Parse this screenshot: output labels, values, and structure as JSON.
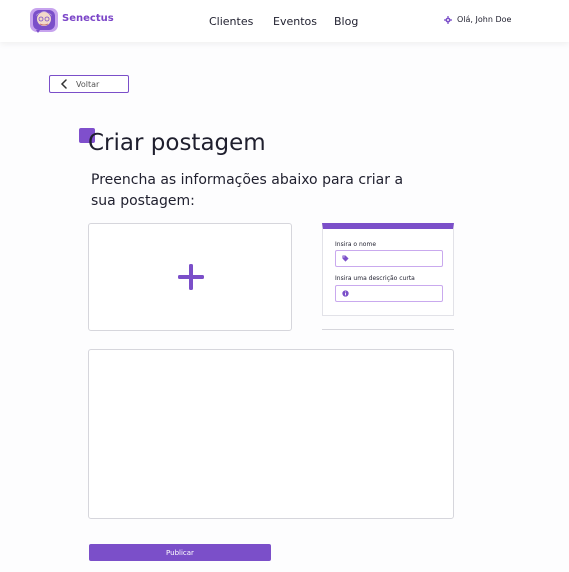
{
  "header": {
    "brand": "Senectus",
    "nav": [
      "Clientes",
      "Eventos",
      "Blog"
    ],
    "user_greeting": "Olá, John Doe"
  },
  "back_label": "Voltar",
  "page": {
    "title": "Criar postagem",
    "subtitle": "Preencha as informações abaixo para criar a sua postagem:"
  },
  "form": {
    "name_label": "Insira o nome",
    "name_value": "",
    "description_label": "Insira uma descrição curta",
    "description_value": ""
  },
  "content_value": "",
  "publish_label": "Publicar",
  "icons": {
    "logo": "grandma-avatar-icon",
    "user": "settings-icon",
    "back": "chevron-left-icon",
    "upload": "plus-icon",
    "name": "tag-icon",
    "description": "info-icon"
  },
  "colors": {
    "accent": "#7b4fc9",
    "field_border": "#c9a9ee"
  }
}
